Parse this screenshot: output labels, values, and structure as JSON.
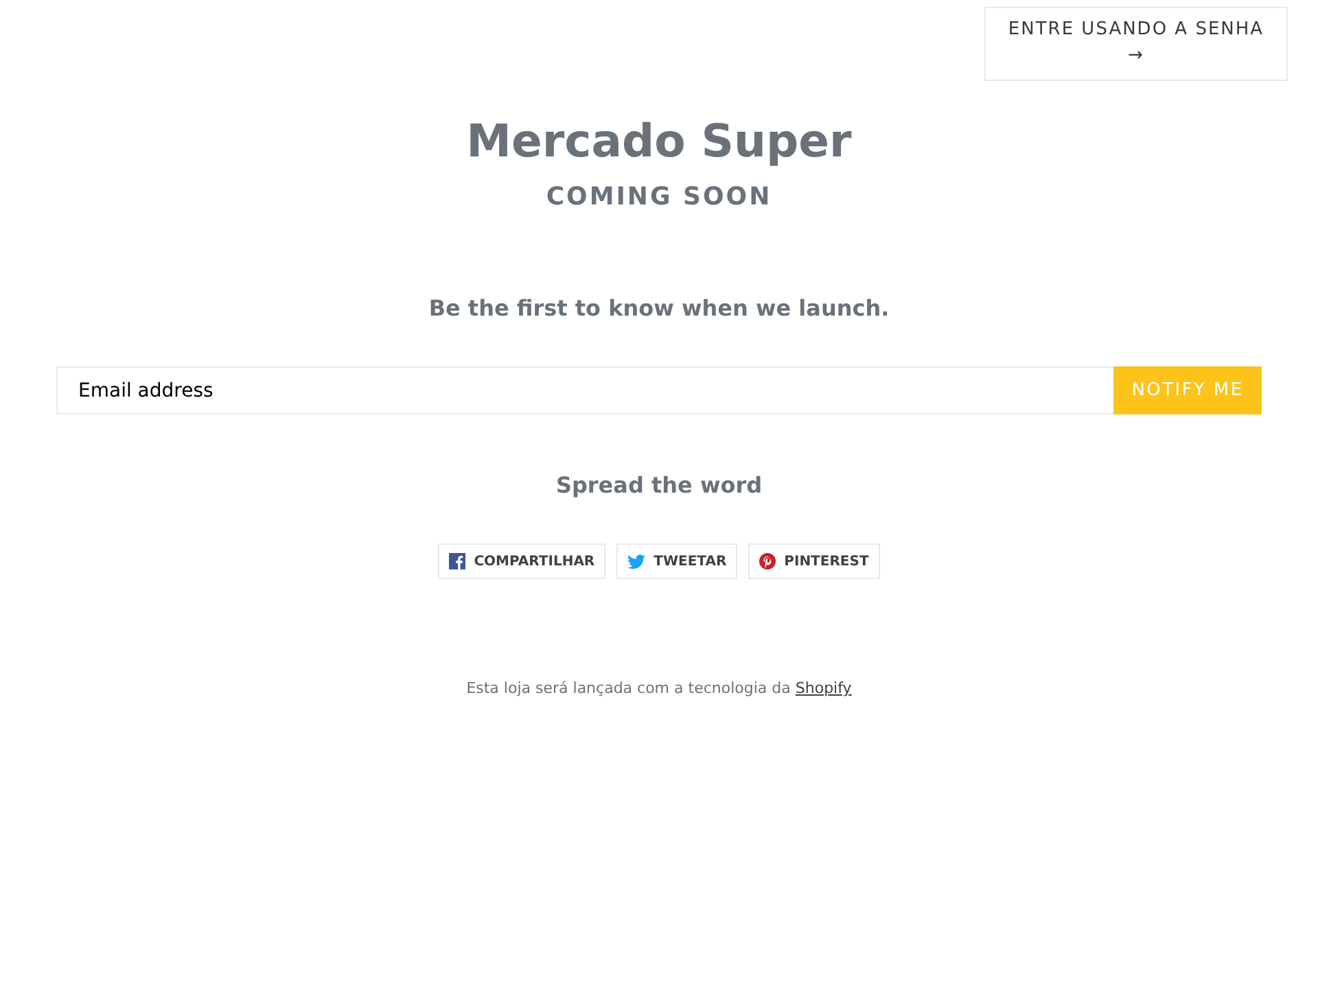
{
  "login_button": {
    "label": "ENTRE USANDO A SENHA",
    "arrow": "→"
  },
  "header": {
    "title": "Mercado Super",
    "subtitle": "COMING SOON"
  },
  "signup": {
    "heading": "Be the first to know when we launch.",
    "email": {
      "placeholder": "Email address"
    },
    "button": "NOTIFY ME"
  },
  "share": {
    "heading": "Spread the word",
    "buttons": [
      {
        "kind": "facebook",
        "label": "COMPARTILHAR"
      },
      {
        "kind": "twitter",
        "label": "TWEETAR"
      },
      {
        "kind": "pinterest",
        "label": "PINTEREST"
      }
    ]
  },
  "footer": {
    "text": "Esta loja será lançada com a tecnologia da",
    "link": "Shopify"
  }
}
